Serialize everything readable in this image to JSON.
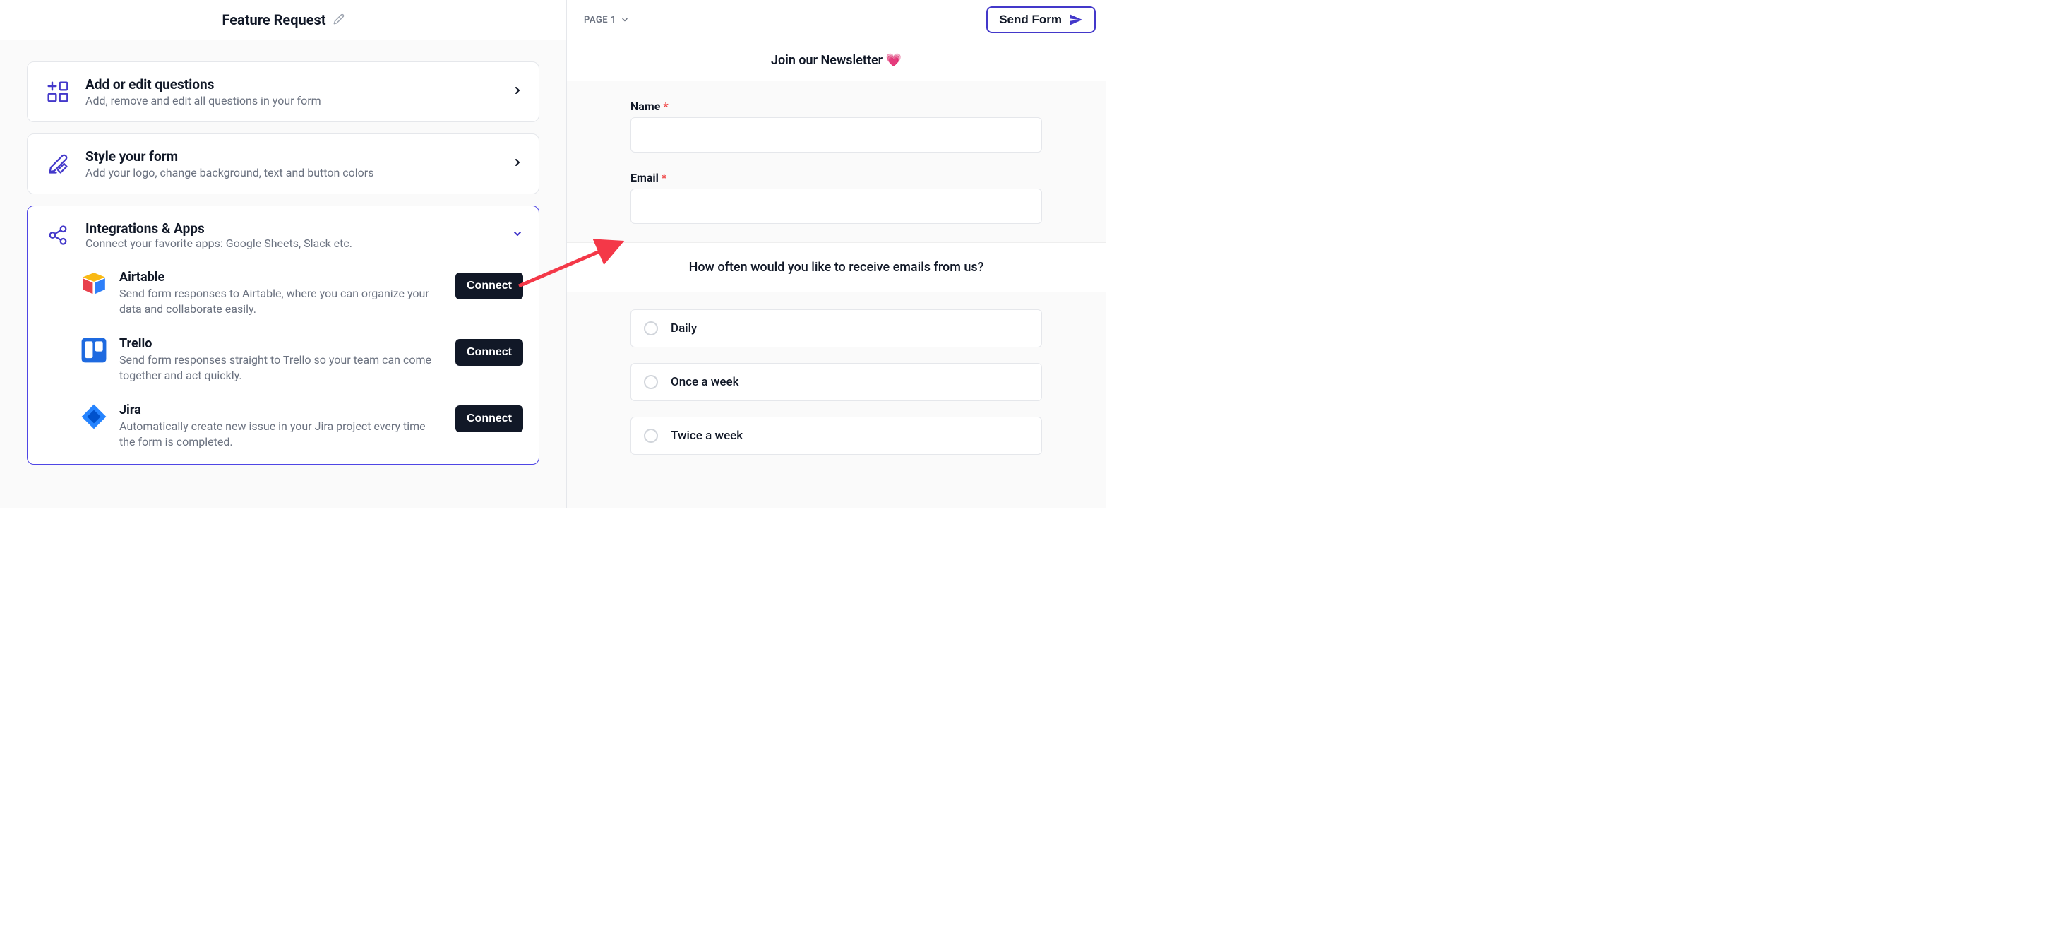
{
  "header": {
    "title": "Feature Request",
    "page_selector": "PAGE 1",
    "send_button": "Send Form"
  },
  "cards": {
    "questions": {
      "title": "Add or edit questions",
      "subtitle": "Add, remove and edit all questions in your form"
    },
    "style": {
      "title": "Style your form",
      "subtitle": "Add your logo, change background, text and button colors"
    },
    "integrations": {
      "title": "Integrations & Apps",
      "subtitle": "Connect your favorite apps: Google Sheets, Slack etc.",
      "items": [
        {
          "name": "Airtable",
          "desc": "Send form responses to Airtable, where you can organize your data and collaborate easily.",
          "button": "Connect"
        },
        {
          "name": "Trello",
          "desc": "Send form responses straight to Trello so your team can come together and act quickly.",
          "button": "Connect"
        },
        {
          "name": "Jira",
          "desc": "Automatically create new issue in your Jira project every time the form is completed.",
          "button": "Connect"
        }
      ]
    }
  },
  "preview": {
    "page_title": "Join our Newsletter 💗",
    "fields": {
      "name_label": "Name",
      "email_label": "Email"
    },
    "question": "How often would you like to receive emails from us?",
    "options": [
      "Daily",
      "Once a week",
      "Twice a week"
    ]
  }
}
